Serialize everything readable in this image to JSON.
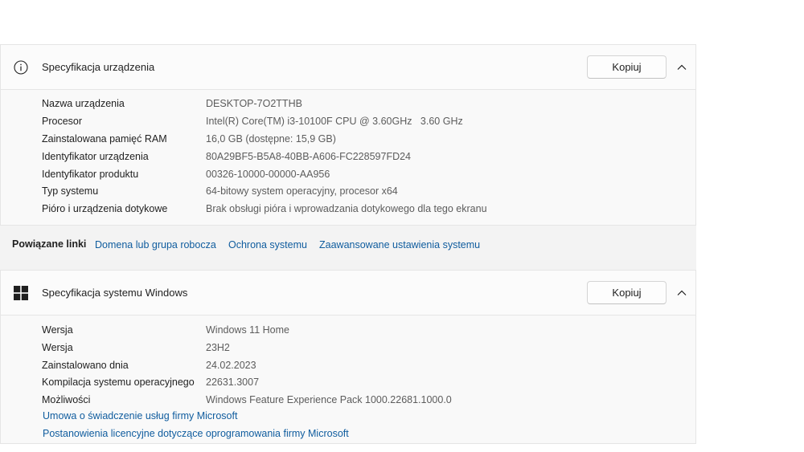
{
  "device_spec": {
    "title": "Specyfikacja urządzenia",
    "copy_label": "Kopiuj",
    "rows": [
      {
        "key": "Nazwa urządzenia",
        "value": "DESKTOP-7O2TTHB"
      },
      {
        "key": "Procesor",
        "value": "Intel(R) Core(TM) i3-10100F CPU @ 3.60GHz   3.60 GHz"
      },
      {
        "key": "Zainstalowana pamięć RAM",
        "value": "16,0 GB (dostępne: 15,9 GB)"
      },
      {
        "key": "Identyfikator urządzenia",
        "value": "80A29BF5-B5A8-40BB-A606-FC228597FD24"
      },
      {
        "key": "Identyfikator produktu",
        "value": "00326-10000-00000-AA956"
      },
      {
        "key": "Typ systemu",
        "value": "64-bitowy system operacyjny, procesor x64"
      },
      {
        "key": "Pióro i urządzenia dotykowe",
        "value": "Brak obsługi pióra i wprowadzania dotykowego dla tego ekranu"
      }
    ]
  },
  "related_links": {
    "label": "Powiązane linki",
    "links": [
      "Domena lub grupa robocza",
      "Ochrona systemu",
      "Zaawansowane ustawienia systemu"
    ]
  },
  "windows_spec": {
    "title": "Specyfikacja systemu Windows",
    "copy_label": "Kopiuj",
    "rows": [
      {
        "key": "Wersja",
        "value": "Windows 11 Home"
      },
      {
        "key": "Wersja",
        "value": "23H2"
      },
      {
        "key": "Zainstalowano dnia",
        "value": "24.02.2023"
      },
      {
        "key": "Kompilacja systemu operacyjnego",
        "value": "22631.3007"
      },
      {
        "key": "Możliwości",
        "value": "Windows Feature Experience Pack 1000.22681.1000.0"
      }
    ],
    "links": [
      "Umowa o świadczenie usług firmy Microsoft",
      "Postanowienia licencyjne dotyczące oprogramowania firmy Microsoft"
    ]
  },
  "colors": {
    "link": "#0f5c9e",
    "value_text": "#5c5c5c",
    "accent_logo": "#1f1f1f"
  },
  "icons": {
    "device_spec": "info-icon",
    "windows_spec": "windows-logo-icon",
    "collapse": "chevron-up-icon"
  }
}
